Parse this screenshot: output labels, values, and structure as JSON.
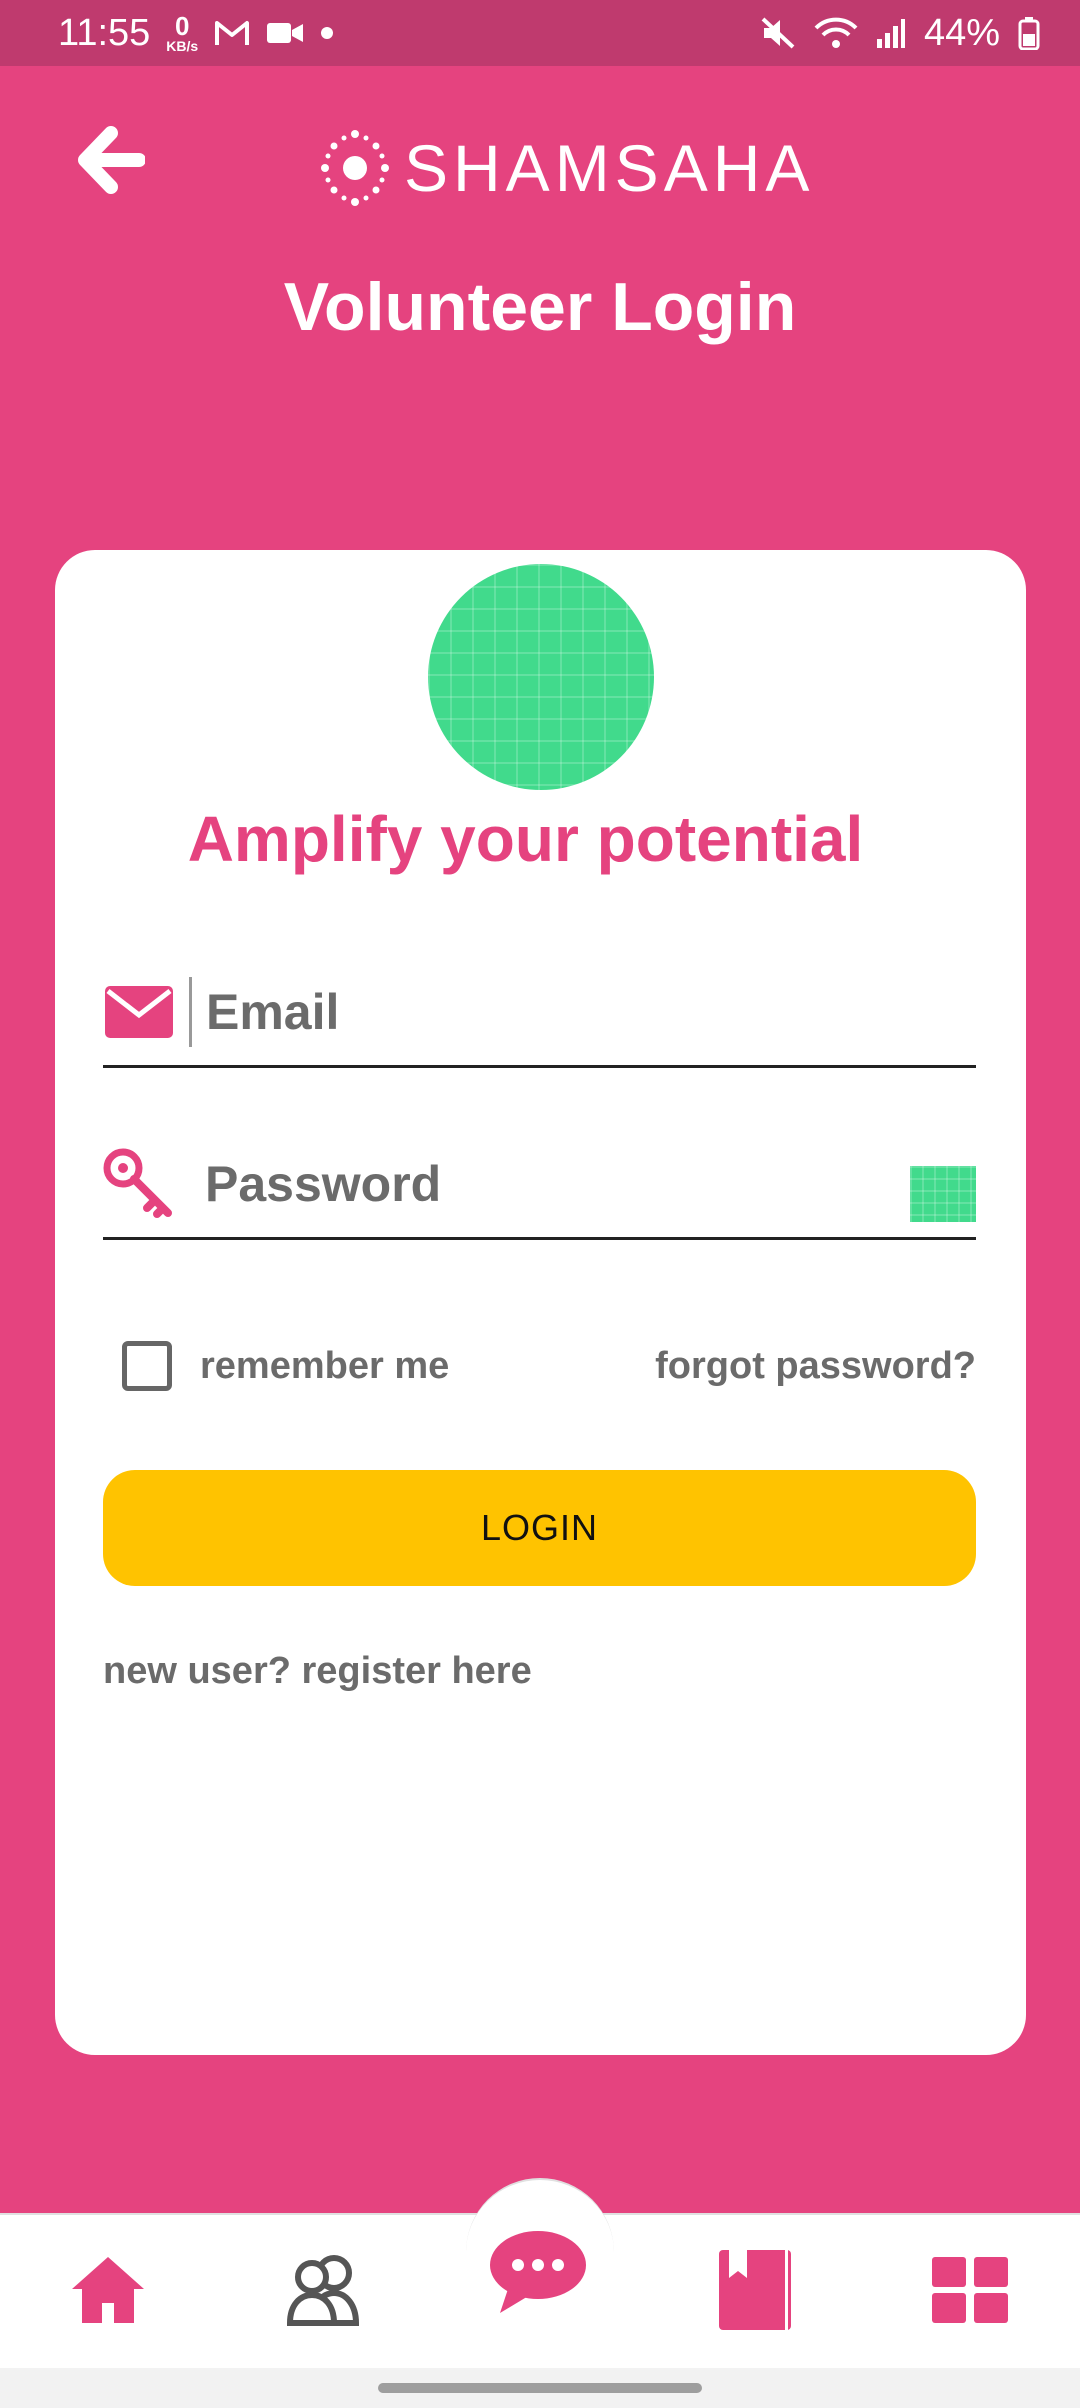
{
  "status_bar": {
    "time": "11:55",
    "net_speed_value": "0",
    "net_speed_unit": "KB/s",
    "battery": "44%"
  },
  "header": {
    "brand": "SHAMSAHA",
    "title": "Volunteer Login"
  },
  "form": {
    "tagline": "Amplify your potential",
    "email_placeholder": "Email",
    "password_placeholder": "Password",
    "remember_label": "remember me",
    "forgot_label": "forgot password?",
    "login_label": "LOGIN",
    "register_label": "new user? register here"
  },
  "nav": {
    "items": [
      "home-icon",
      "community-icon",
      "chat-icon",
      "book-icon",
      "grid-icon"
    ]
  },
  "colors": {
    "brand_pink": "#E5437F",
    "status_bar": "#BF3A6E",
    "button_yellow": "#FFC300",
    "placeholder_green": "#41DA8C"
  }
}
